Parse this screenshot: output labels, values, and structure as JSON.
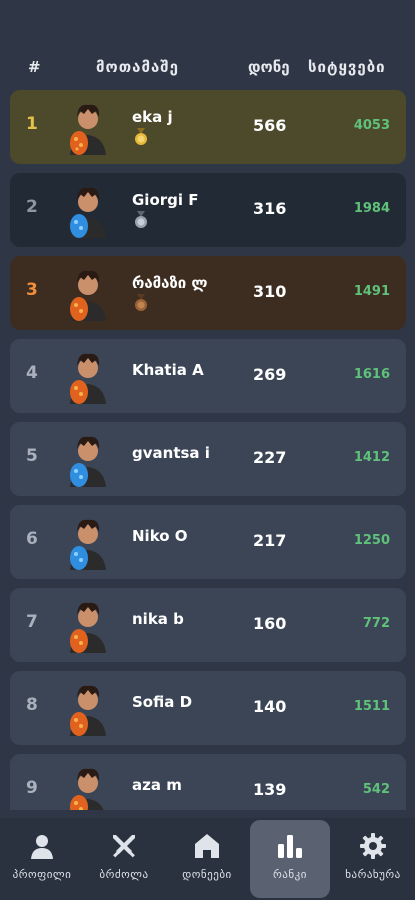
{
  "header": {
    "rank": "#",
    "player": "მოთამაშე",
    "level": "დონე",
    "words": "სიტყვები"
  },
  "rows": [
    {
      "rank": "1",
      "name": "eka j",
      "level": "566",
      "score": "4053",
      "medal": "gold-medal-icon",
      "avatar": "orange"
    },
    {
      "rank": "2",
      "name": "Giorgi F",
      "level": "316",
      "score": "1984",
      "medal": "silver-medal-icon",
      "avatar": "blue"
    },
    {
      "rank": "3",
      "name": "რამაზი ლ",
      "level": "310",
      "score": "1491",
      "medal": "bronze-medal-icon",
      "avatar": "orange"
    },
    {
      "rank": "4",
      "name": "Khatia A",
      "level": "269",
      "score": "1616",
      "avatar": "orange"
    },
    {
      "rank": "5",
      "name": "gvantsa i",
      "level": "227",
      "score": "1412",
      "avatar": "blue"
    },
    {
      "rank": "6",
      "name": "Niko O",
      "level": "217",
      "score": "1250",
      "avatar": "blue"
    },
    {
      "rank": "7",
      "name": "nika b",
      "level": "160",
      "score": "772",
      "avatar": "orange"
    },
    {
      "rank": "8",
      "name": "Sofia D",
      "level": "140",
      "score": "1511",
      "avatar": "orange"
    },
    {
      "rank": "9",
      "name": "aza m",
      "level": "139",
      "score": "542",
      "avatar": "orange"
    }
  ],
  "nav": [
    {
      "label": "პროფილი",
      "icon": "profile-icon"
    },
    {
      "label": "ბრძოლა",
      "icon": "swords-icon"
    },
    {
      "label": "დონეები",
      "icon": "home-icon"
    },
    {
      "label": "რანკი",
      "icon": "ranking-icon",
      "active": true
    },
    {
      "label": "ხარახურა",
      "icon": "gear-icon"
    }
  ],
  "colors": {
    "background": "#2f3746",
    "row": "#3c4556",
    "gold_row": "#4d4a2b",
    "silver_row": "#222b35",
    "bronze_row": "#3d2c20",
    "score": "#5fc27a",
    "nav": "#2a3240",
    "nav_active": "#5a6272"
  }
}
